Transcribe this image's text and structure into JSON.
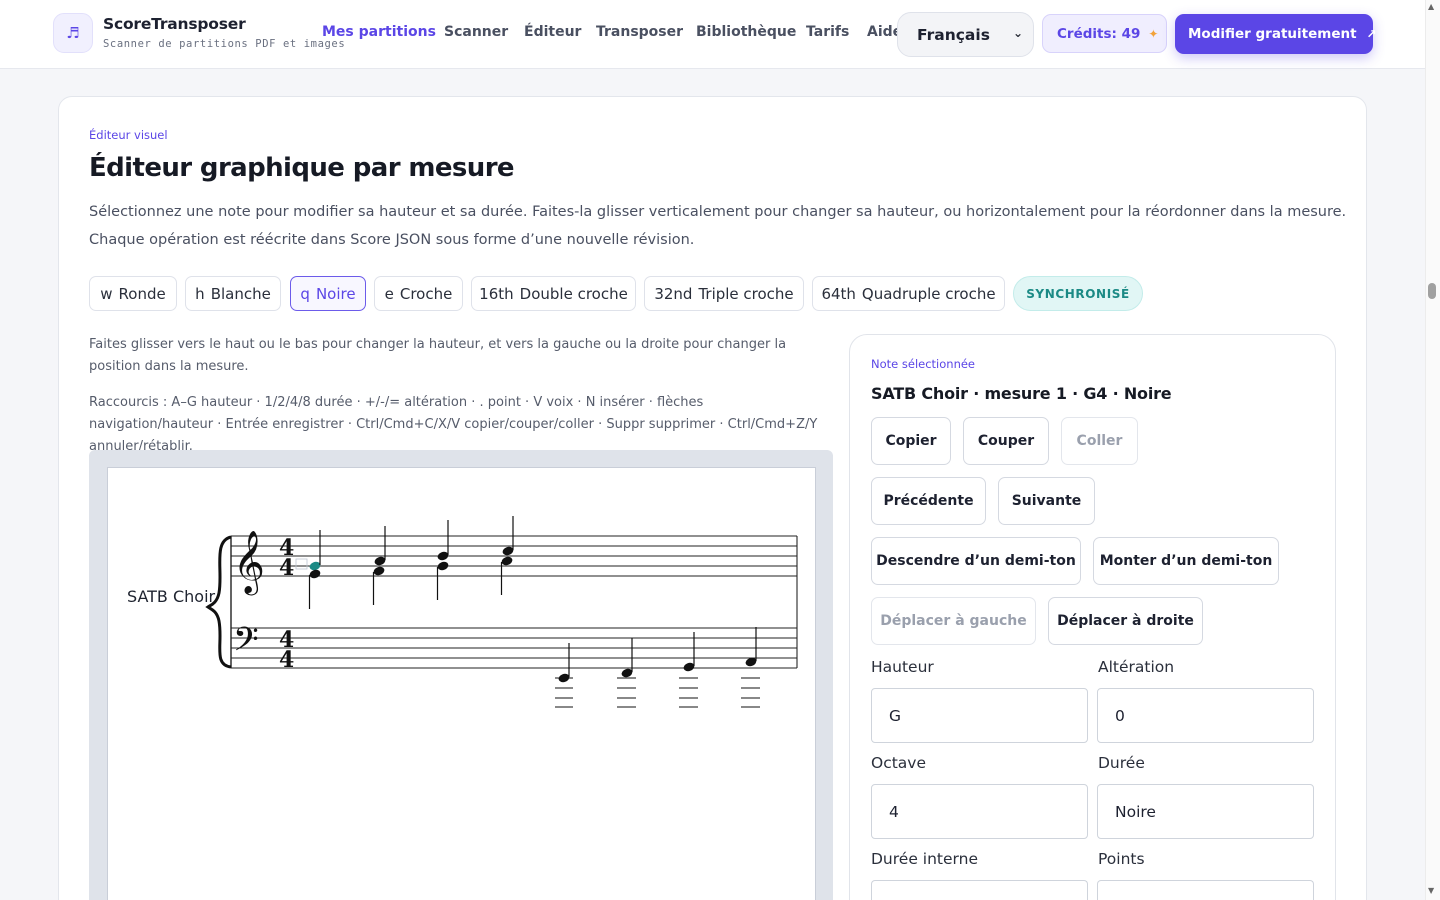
{
  "header": {
    "brand_name": "ScoreTransposer",
    "brand_subtitle": "Scanner de partitions PDF et images",
    "nav": [
      {
        "label": "Mes partitions",
        "active": true
      },
      {
        "label": "Scanner",
        "active": false
      },
      {
        "label": "Éditeur",
        "active": false
      },
      {
        "label": "Transposer",
        "active": false
      },
      {
        "label": "Bibliothèque",
        "active": false
      },
      {
        "label": "Tarifs",
        "active": false
      },
      {
        "label": "Aide",
        "active": false
      }
    ],
    "language": "Français",
    "credits": "Crédits: 49",
    "cta": "Modifier gratuitement",
    "colors": {
      "accent": "#5b46e6",
      "sync": "#1b8a85"
    }
  },
  "editor": {
    "eyebrow": "Éditeur visuel",
    "title": "Éditeur graphique par mesure",
    "description": "Sélectionnez une note pour modifier sa hauteur et sa durée. Faites-la glisser verticalement pour changer sa hauteur, ou horizontalement pour la réordonner dans la mesure. Chaque opération est réécrite dans Score JSON sous forme d’une nouvelle révision.",
    "durations": [
      {
        "symbol": "w",
        "label": "Ronde",
        "selected": false
      },
      {
        "symbol": "h",
        "label": "Blanche",
        "selected": false
      },
      {
        "symbol": "q",
        "label": "Noire",
        "selected": true
      },
      {
        "symbol": "e",
        "label": "Croche",
        "selected": false
      },
      {
        "symbol": "16th",
        "label": "Double croche",
        "selected": false
      },
      {
        "symbol": "32nd",
        "label": "Triple croche",
        "selected": false
      },
      {
        "symbol": "64th",
        "label": "Quadruple croche",
        "selected": false
      }
    ],
    "sync_status": "SYNCHRONISÉ",
    "help_drag": "Faites glisser vers le haut ou le bas pour changer la hauteur, et vers la gauche ou la droite pour changer la position dans la mesure.",
    "help_shortcuts": "Raccourcis : A–G hauteur · 1/2/4/8 durée · +/-/= altération · . point · V voix · N insérer · flèches navigation/hauteur · Entrée enregistrer · Ctrl/Cmd+C/X/V copier/couper/coller · Suppr supprimer · Ctrl/Cmd+Z/Y annuler/rétablir.",
    "part_name": "SATB Choir",
    "time_signature": "4/4"
  },
  "panel": {
    "eyebrow": "Note sélectionnée",
    "title": "SATB Choir · mesure 1 · G4 · Noire",
    "buttons": {
      "copy": "Copier",
      "cut": "Couper",
      "paste": "Coller",
      "previous": "Précédente",
      "next": "Suivante",
      "semitone_down": "Descendre d’un demi-ton",
      "semitone_up": "Monter d’un demi-ton",
      "move_left": "Déplacer à gauche",
      "move_right": "Déplacer à droite"
    },
    "fields": {
      "pitch_label": "Hauteur",
      "pitch_value": "G",
      "accidental_label": "Altération",
      "accidental_value": "0",
      "octave_label": "Octave",
      "octave_value": "4",
      "duration_label": "Durée",
      "duration_value": "Noire",
      "internal_duration_label": "Durée interne",
      "dots_label": "Points"
    }
  }
}
